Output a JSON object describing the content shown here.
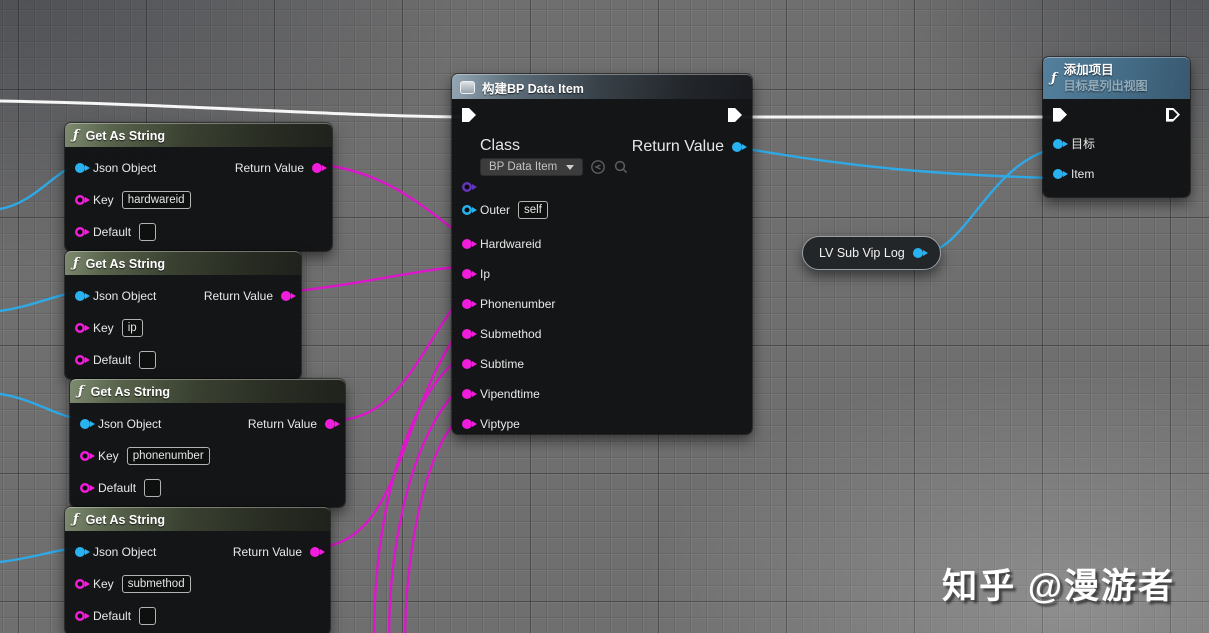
{
  "colors": {
    "exec_wire": "#f6f6f6",
    "string_pin": "#f01edb",
    "object_pin": "#29b2f2",
    "class_pin": "#6436bb",
    "string_wire": "#dd16cc",
    "object_wire": "#2fa9e6",
    "function_header": "#6f7e63",
    "construct_header": "#5d6e7b",
    "target_header": "#47708b"
  },
  "get_as_string_nodes": [
    {
      "title": "Get As String",
      "json_object_label": "Json Object",
      "return_value_label": "Return Value",
      "key_label": "Key",
      "key_value": "hardwareid",
      "default_label": "Default",
      "default_value": ""
    },
    {
      "title": "Get As String",
      "json_object_label": "Json Object",
      "return_value_label": "Return Value",
      "key_label": "Key",
      "key_value": "ip",
      "default_label": "Default",
      "default_value": ""
    },
    {
      "title": "Get As String",
      "json_object_label": "Json Object",
      "return_value_label": "Return Value",
      "key_label": "Key",
      "key_value": "phonenumber",
      "default_label": "Default",
      "default_value": ""
    },
    {
      "title": "Get As String",
      "json_object_label": "Json Object",
      "return_value_label": "Return Value",
      "key_label": "Key",
      "key_value": "submethod",
      "default_label": "Default",
      "default_value": ""
    }
  ],
  "construct_node": {
    "title": "构建BP Data Item",
    "class_label": "Class",
    "class_value": "BP Data Item",
    "return_value_label": "Return Value",
    "outer_label": "Outer",
    "outer_value": "self",
    "input_pins": [
      "Hardwareid",
      "Ip",
      "Phonenumber",
      "Submethod",
      "Subtime",
      "Vipendtime",
      "Viptype"
    ]
  },
  "variable_node": {
    "label": "LV Sub Vip Log"
  },
  "add_item_node": {
    "title": "添加项目",
    "subtitle": "目标是列出视图",
    "target_pin_label": "目标",
    "item_pin_label": "Item"
  },
  "watermark": {
    "text": "知乎 @漫游者"
  }
}
